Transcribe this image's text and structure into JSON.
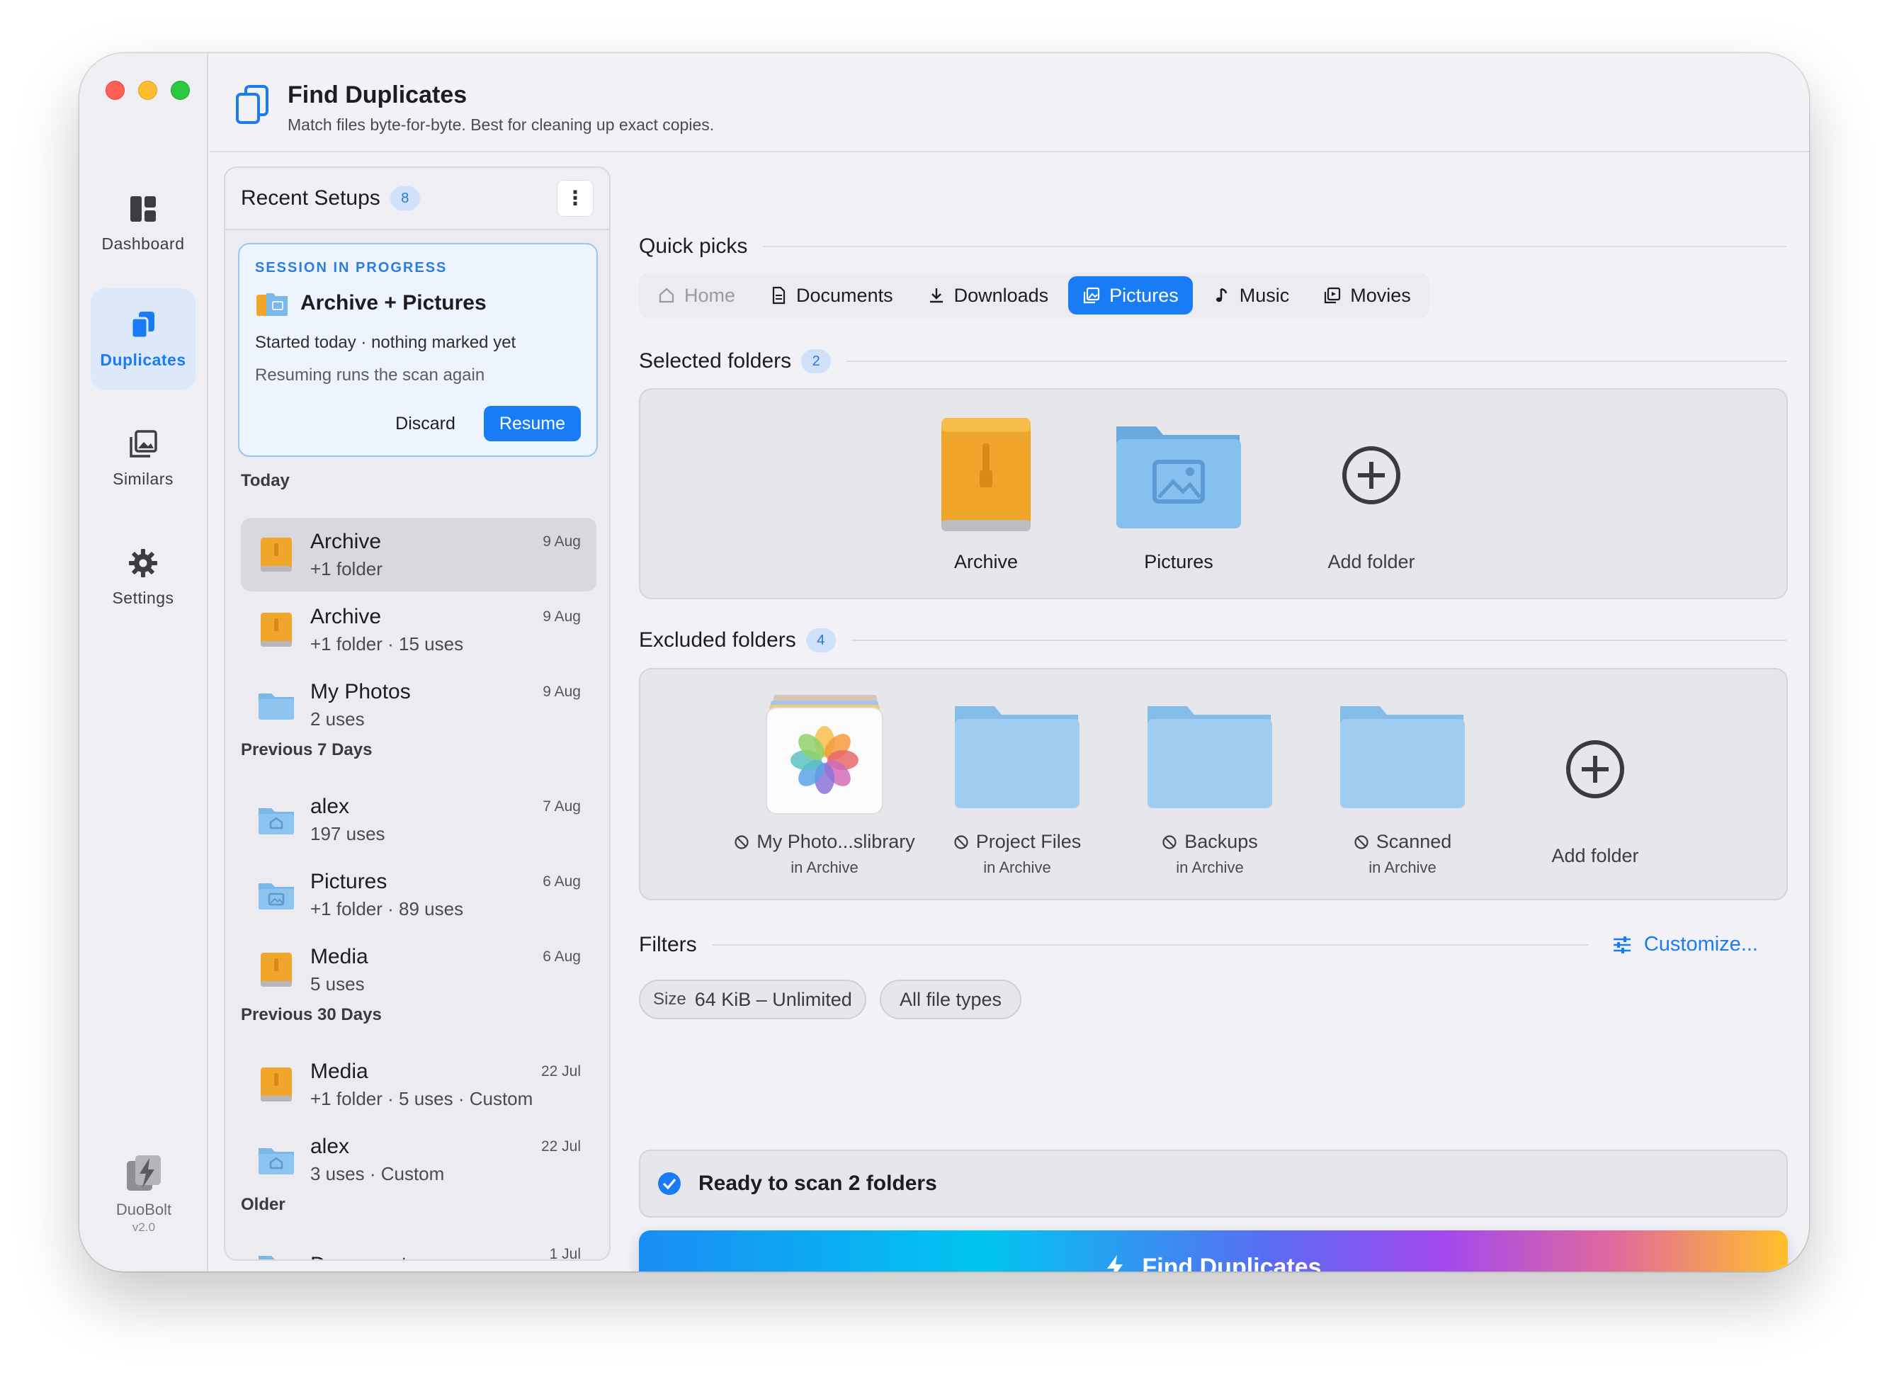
{
  "window": {
    "controls": [
      "close",
      "minimize",
      "zoom"
    ]
  },
  "sidebar": {
    "items": [
      {
        "label": "Dashboard",
        "icon": "dashboard-icon",
        "active": false
      },
      {
        "label": "Duplicates",
        "icon": "duplicates-icon",
        "active": true
      },
      {
        "label": "Similars",
        "icon": "similars-icon",
        "active": false
      },
      {
        "label": "Settings",
        "icon": "gear-icon",
        "active": false
      }
    ],
    "brand": {
      "name": "DuoBolt",
      "version": "v2.0"
    }
  },
  "header": {
    "title": "Find Duplicates",
    "subtitle": "Match files byte-for-byte. Best for cleaning up exact copies."
  },
  "recent": {
    "title": "Recent Setups",
    "count": "8",
    "more_icon": "⋮",
    "session": {
      "tag": "SESSION IN PROGRESS",
      "name": "Archive + Pictures",
      "line1": "Started today · nothing marked yet",
      "line2": "Resuming runs the scan again",
      "discard": "Discard",
      "resume": "Resume"
    },
    "sections": {
      "today": "Today",
      "prev7": "Previous 7 Days",
      "prev30": "Previous 30 Days",
      "older": "Older"
    },
    "items": [
      {
        "name": "Archive",
        "sub": "+1 folder",
        "date": "9 Aug",
        "icon": "drive-icon"
      },
      {
        "name": "Archive",
        "sub": "+1 folder · 15 uses",
        "date": "9 Aug",
        "icon": "drive-icon"
      },
      {
        "name": "My Photos",
        "sub": "2 uses",
        "date": "9 Aug",
        "icon": "folder-icon"
      },
      {
        "name": "alex",
        "sub": "197 uses",
        "date": "7 Aug",
        "icon": "home-folder-icon"
      },
      {
        "name": "Pictures",
        "sub": "+1 folder · 89 uses",
        "date": "6 Aug",
        "icon": "pictures-folder-icon"
      },
      {
        "name": "Media",
        "sub": "5 uses",
        "date": "6 Aug",
        "icon": "drive-icon"
      },
      {
        "name": "Media",
        "sub": "+1 folder · 5 uses · Custom",
        "date": "22 Jul",
        "icon": "drive-icon"
      },
      {
        "name": "alex",
        "sub": "3 uses · Custom",
        "date": "22 Jul",
        "icon": "home-folder-icon"
      },
      {
        "name": "Documents",
        "sub": "",
        "date": "1 Jul",
        "icon": "folder-icon"
      }
    ]
  },
  "quick_picks": {
    "title": "Quick picks",
    "chips": [
      {
        "label": "Home",
        "icon": "home-icon",
        "state": "disabled"
      },
      {
        "label": "Documents",
        "icon": "document-icon",
        "state": "normal"
      },
      {
        "label": "Downloads",
        "icon": "download-icon",
        "state": "normal"
      },
      {
        "label": "Pictures",
        "icon": "picture-icon",
        "state": "active"
      },
      {
        "label": "Music",
        "icon": "music-note-icon",
        "state": "normal"
      },
      {
        "label": "Movies",
        "icon": "movie-icon",
        "state": "normal"
      }
    ]
  },
  "selected": {
    "title": "Selected folders",
    "count": "2",
    "folders": [
      {
        "label": "Archive",
        "icon": "external-drive-icon"
      },
      {
        "label": "Pictures",
        "icon": "pictures-folder-icon"
      }
    ],
    "add_label": "Add folder"
  },
  "excluded": {
    "title": "Excluded folders",
    "count": "4",
    "folders": [
      {
        "label": "My Photo...slibrary",
        "sub": "in Archive",
        "icon": "photos-library-icon"
      },
      {
        "label": "Project Files",
        "sub": "in Archive",
        "icon": "folder-icon"
      },
      {
        "label": "Backups",
        "sub": "in Archive",
        "icon": "folder-icon"
      },
      {
        "label": "Scanned",
        "sub": "in Archive",
        "icon": "folder-icon"
      }
    ],
    "add_label": "Add folder"
  },
  "filters": {
    "title": "Filters",
    "customize": "Customize...",
    "size_key": "Size",
    "size_value": "64 KiB – Unlimited",
    "types": "All file types"
  },
  "status": {
    "text": "Ready to scan 2 folders"
  },
  "cta": {
    "label": "Find Duplicates"
  },
  "colors": {
    "accent": "#1a7cf5",
    "cta_gradient": [
      "#1a8cf5",
      "#00c6ef",
      "#a248ee",
      "#ffc02a"
    ],
    "folder_blue": "#7ab8ea",
    "drive_orange": "#f0a62a"
  }
}
